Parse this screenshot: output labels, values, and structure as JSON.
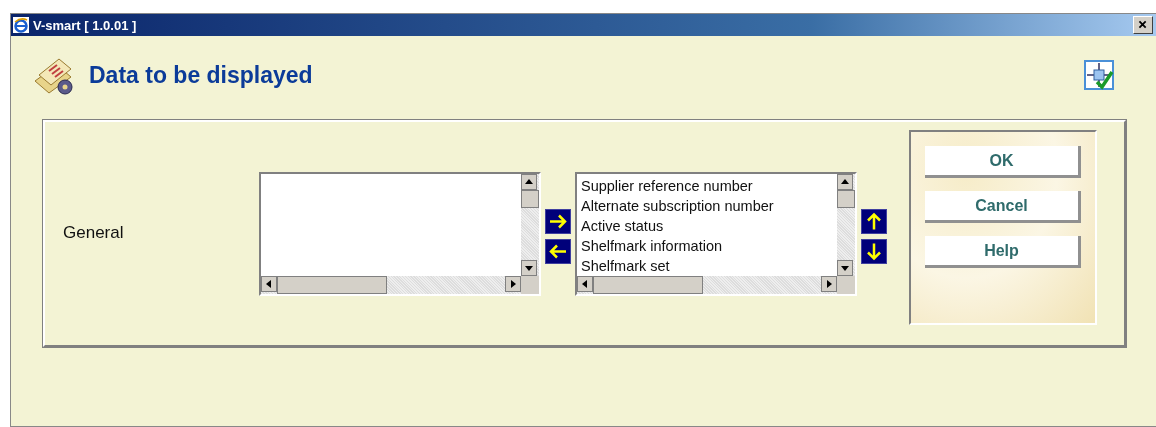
{
  "window": {
    "title": "V-smart [ 1.0.01 ]"
  },
  "header": {
    "title": "Data to be displayed"
  },
  "section": {
    "label": "General"
  },
  "selected_list": {
    "items": [
      {
        "text": "Supplier reference number"
      },
      {
        "text": "Alternate subscription number"
      },
      {
        "text": "Active status"
      },
      {
        "text": "Shelfmark information"
      },
      {
        "text": "Shelfmark set"
      }
    ]
  },
  "buttons": [
    {
      "label": "OK"
    },
    {
      "label": "Cancel"
    },
    {
      "label": "Help"
    }
  ]
}
